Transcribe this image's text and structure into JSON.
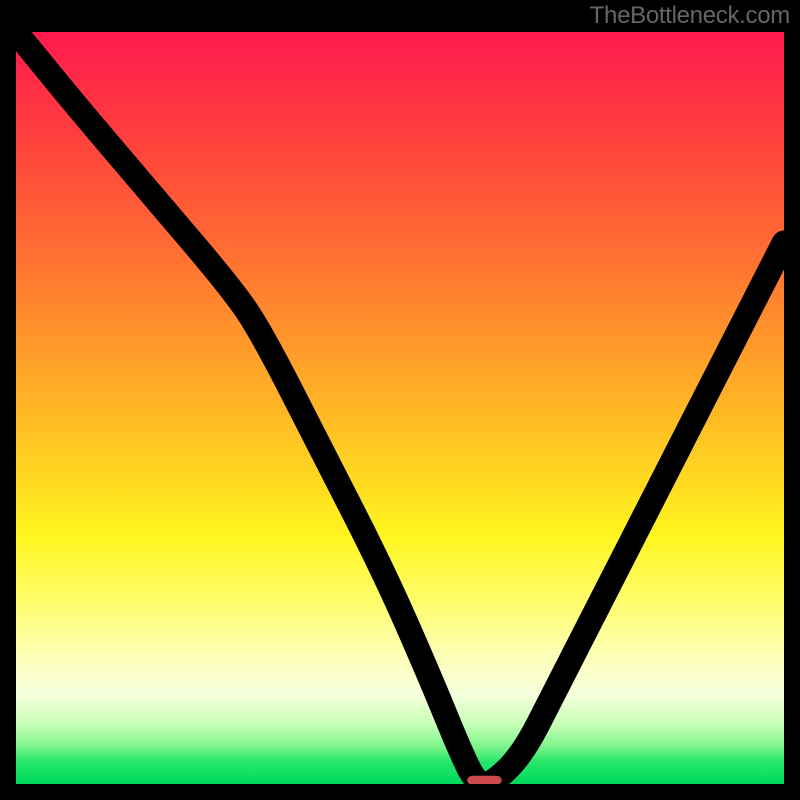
{
  "watermark": "TheBottleneck.com",
  "chart_data": {
    "type": "line",
    "title": "",
    "xlabel": "",
    "ylabel": "",
    "xlim": [
      0,
      100
    ],
    "ylim": [
      0,
      100
    ],
    "grid": false,
    "legend": false,
    "series": [
      {
        "name": "bottleneck-curve",
        "x": [
          0,
          8,
          18,
          28,
          32,
          40,
          48,
          54,
          58,
          60,
          62,
          66,
          70,
          76,
          84,
          92,
          100
        ],
        "values": [
          100,
          90,
          78,
          66,
          60,
          44,
          28,
          14,
          4,
          0,
          0,
          4,
          12,
          24,
          40,
          56,
          72
        ]
      }
    ],
    "marker": {
      "x": 61,
      "y": 0.5,
      "width": 4.5,
      "height": 1.2,
      "color": "#cc4a4a"
    },
    "gradient_stops": [
      {
        "pos": 0,
        "color": "#ff1a4f"
      },
      {
        "pos": 12,
        "color": "#ff3a3f"
      },
      {
        "pos": 28,
        "color": "#ff6a33"
      },
      {
        "pos": 42,
        "color": "#ff9a2a"
      },
      {
        "pos": 55,
        "color": "#ffc822"
      },
      {
        "pos": 67,
        "color": "#fff51f"
      },
      {
        "pos": 76,
        "color": "#fffd6e"
      },
      {
        "pos": 83,
        "color": "#fdffb8"
      },
      {
        "pos": 88,
        "color": "#f6ffdc"
      },
      {
        "pos": 92,
        "color": "#c8ffb8"
      },
      {
        "pos": 95,
        "color": "#7ff58a"
      },
      {
        "pos": 97,
        "color": "#28e66b"
      },
      {
        "pos": 100,
        "color": "#00d95d"
      }
    ]
  }
}
